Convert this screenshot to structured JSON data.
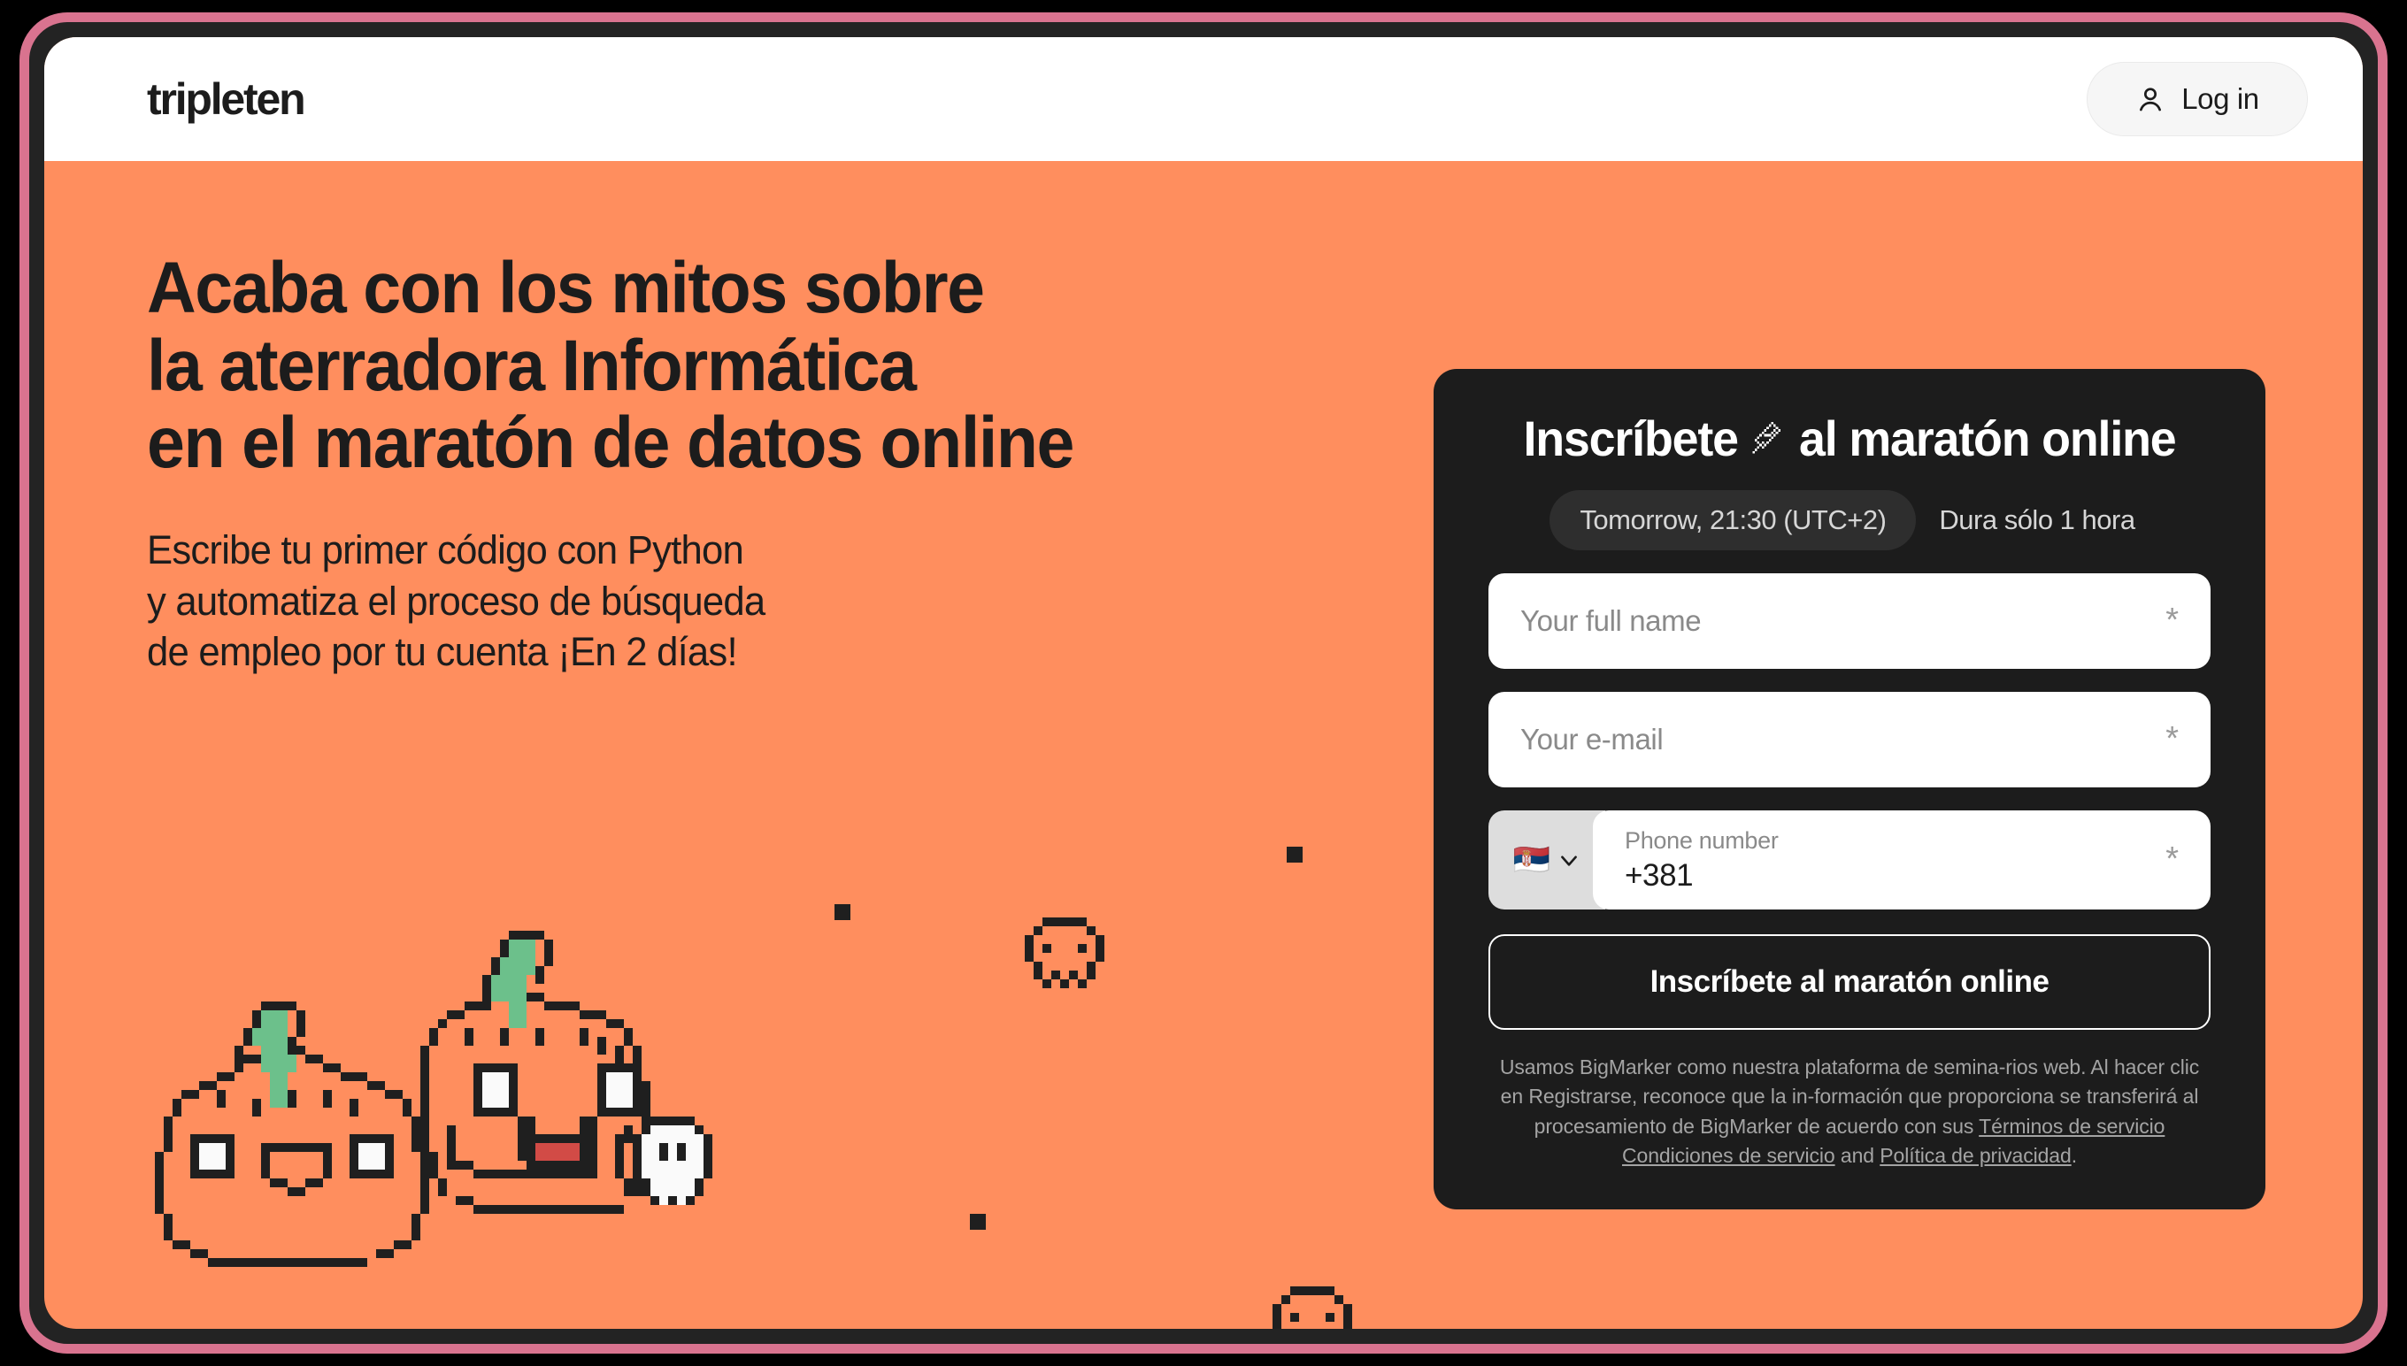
{
  "theme": {
    "frame_ring": "#d9738f",
    "frame_gap": "#232323",
    "page_bg": "#ff8e5e",
    "card_bg": "#1c1c1c",
    "ink": "#1c1c1c",
    "pumpkin_stem": "#6cc08b",
    "tongue": "#d24b46"
  },
  "header": {
    "logo": "tripleten",
    "login_label": "Log in",
    "user_icon": "user-icon"
  },
  "hero": {
    "headline": "Acaba con los mitos sobre\nla aterradora Informática\nen el maratón de datos online",
    "subheadline": "Escribe tu primer código con Python\ny automatiza el proceso de búsqueda\nde empleo por tu cuenta ¡En 2 días!"
  },
  "form": {
    "title_before": "Inscríbete",
    "title_after": "al maratón online",
    "pin_icon": "pushpin-icon",
    "time_pill": "Tomorrow, 21:30 (UTC+2)",
    "duration": "Dura sólo 1 hora",
    "required_mark": "*",
    "fields": [
      {
        "name": "full-name",
        "placeholder": "Your full name"
      },
      {
        "name": "email",
        "placeholder": "Your e-mail"
      }
    ],
    "phone": {
      "flag": "🇷🇸",
      "flag_name": "serbia-flag-icon",
      "chevron": "chevron-down-icon",
      "label": "Phone number",
      "value": "+381"
    },
    "submit_label": "Inscríbete al maratón online",
    "legal": {
      "text_1": "Usamos BigMarker como nuestra plataforma de semina-rios web. Al hacer clic en Registrarse, reconoce que la in-formación que proporciona se transferirá al procesamiento de BigMarker de acuerdo con sus ",
      "link_1": "Términos de servicio Condiciones de servicio",
      "text_2": " and ",
      "link_2": "Política de privacidad",
      "text_3": "."
    }
  }
}
